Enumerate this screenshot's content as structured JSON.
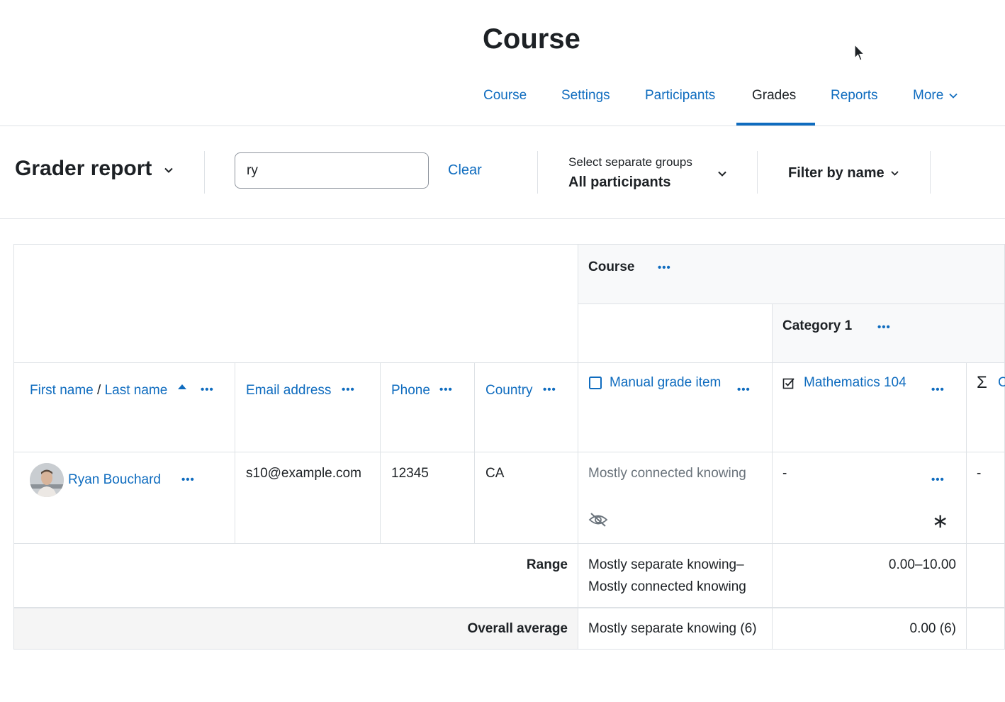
{
  "header": {
    "page_title": "Course"
  },
  "course_nav": {
    "tabs": [
      {
        "label": "Course"
      },
      {
        "label": "Settings"
      },
      {
        "label": "Participants"
      },
      {
        "label": "Grades",
        "active": true
      },
      {
        "label": "Reports"
      },
      {
        "label": "More"
      }
    ]
  },
  "toolbar": {
    "report_title": "Grader report",
    "search_value": "ry",
    "clear_label": "Clear",
    "groups_label": "Select separate groups",
    "groups_value": "All participants",
    "filter_label": "Filter by name"
  },
  "grid": {
    "course_category": "Course",
    "category_1": "Category 1",
    "columns": {
      "name_first": "First name",
      "name_sep": " / ",
      "name_last": "Last name",
      "email": "Email address",
      "phone": "Phone",
      "country": "Country",
      "manual_item": "Manual grade item",
      "math_item": "Mathematics 104",
      "course_total": "C"
    },
    "row": {
      "name": "Ryan Bouchard",
      "email": "s10@example.com",
      "phone": "12345",
      "country": "CA",
      "manual_grade": "Mostly connected knowing",
      "math_grade": "-",
      "total_grade": "-"
    },
    "range": {
      "label": "Range",
      "manual_line1": "Mostly separate knowing–",
      "manual_line2": "Mostly connected knowing",
      "math": "0.00–10.00"
    },
    "average": {
      "label": "Overall average",
      "manual": "Mostly separate knowing (6)",
      "math": "0.00 (6)"
    }
  },
  "colors": {
    "accent": "#0f6cbf",
    "text": "#1d2125",
    "border": "#dee2e6"
  }
}
